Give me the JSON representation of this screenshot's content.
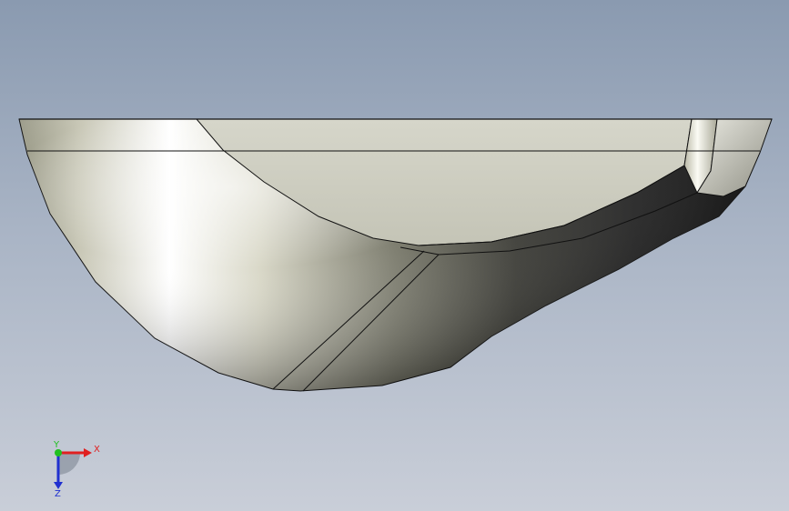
{
  "viewport": {
    "background_top": "#8a9ab0",
    "background_bottom": "#c9ced8",
    "model": {
      "shape": "curved-shell-part",
      "body_color": "#d7d6c6",
      "top_face_color": "#cfcfc2",
      "edge_color": "#1a1a1a"
    },
    "triad": {
      "x_label": "X",
      "y_label": "Y",
      "z_label": "Z",
      "x_color": "#e02020",
      "y_color": "#20c020",
      "z_color": "#2030d0"
    }
  }
}
